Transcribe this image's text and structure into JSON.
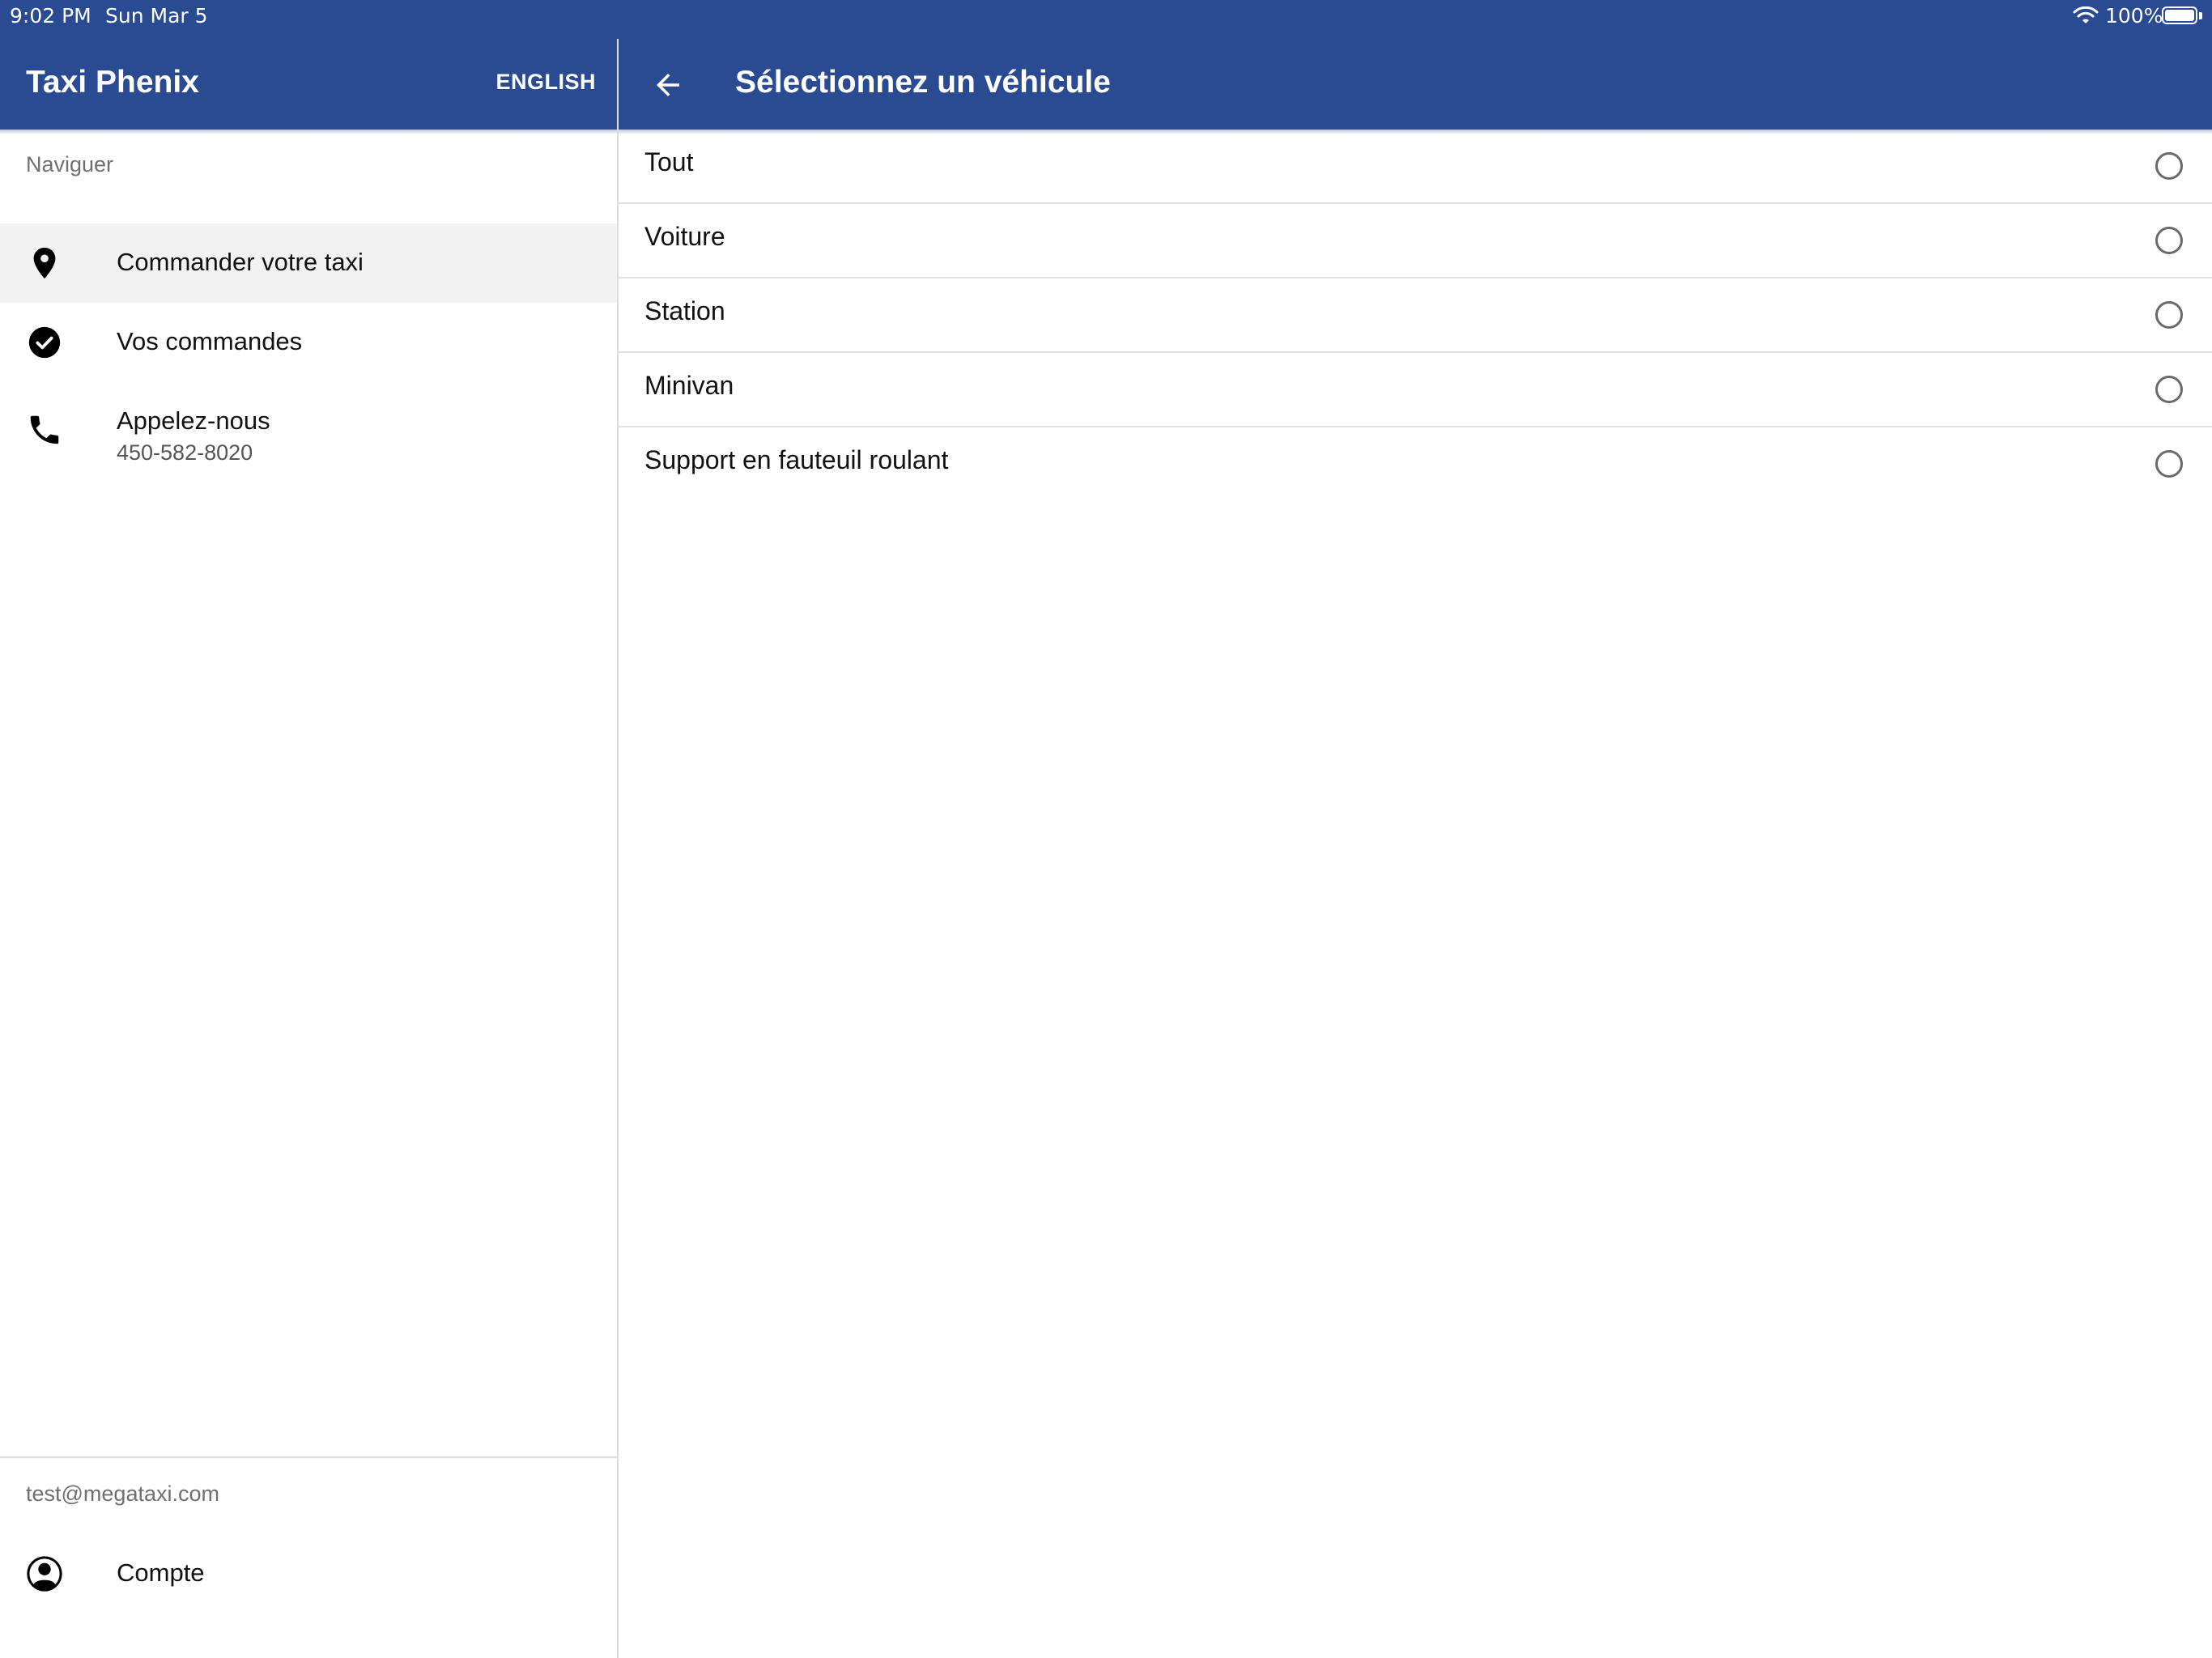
{
  "status_bar": {
    "time": "9:02 PM",
    "date": "Sun Mar 5",
    "battery": "100%"
  },
  "colors": {
    "app_bar": "#2a4a91",
    "active_item_bg": "#f2f2f2"
  },
  "drawer": {
    "app_title": "Taxi Phenix",
    "language_button": "ENGLISH",
    "section_label": "Naviguer",
    "items": [
      {
        "label": "Commander votre taxi",
        "icon": "location-pin-icon",
        "active": true
      },
      {
        "label": "Vos commandes",
        "icon": "check-circle-icon",
        "active": false
      },
      {
        "label": "Appelez-nous",
        "sublabel": "450-582-8020",
        "icon": "phone-icon",
        "active": false
      }
    ],
    "account": {
      "email": "test@megataxi.com",
      "label": "Compte",
      "icon": "account-icon"
    }
  },
  "main": {
    "title": "Sélectionnez un véhicule",
    "back_icon": "arrow-back-icon",
    "options": [
      {
        "label": "Tout",
        "selected": false
      },
      {
        "label": "Voiture",
        "selected": false
      },
      {
        "label": "Station",
        "selected": false
      },
      {
        "label": "Minivan",
        "selected": false
      },
      {
        "label": "Support en fauteuil roulant",
        "selected": false
      }
    ]
  }
}
